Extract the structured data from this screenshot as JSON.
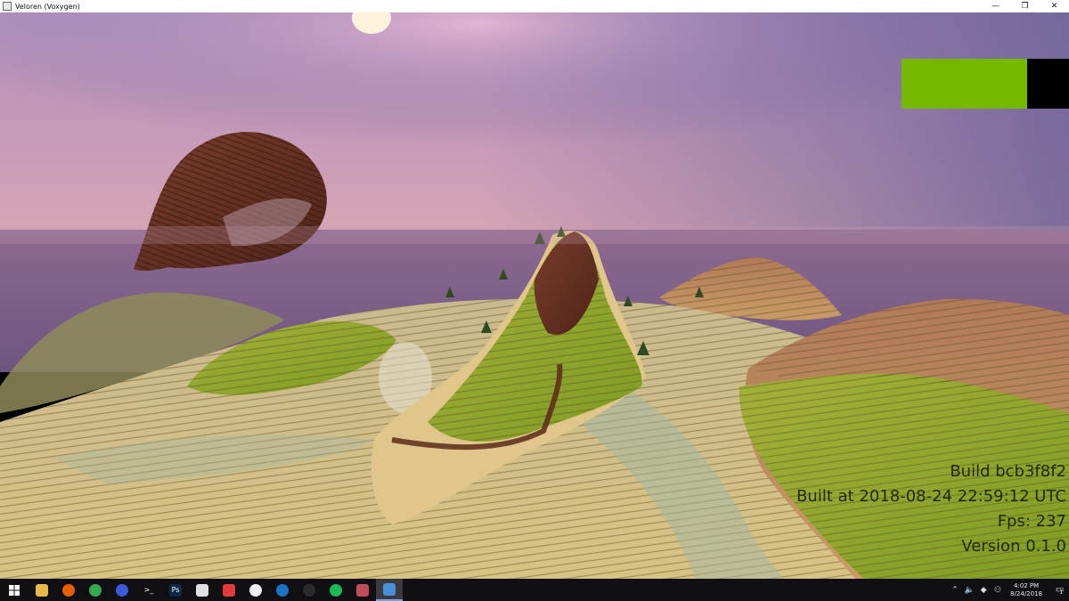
{
  "window": {
    "title": "Veloren (Voxygen)",
    "minimize": "—",
    "restore": "❐",
    "close": "✕"
  },
  "hud": {
    "bar_fill_fraction": 0.75,
    "bar_fill_color": "#74b800",
    "bar_empty_color": "#000000",
    "build_label": "Build bcb3f8f2",
    "built_at_label": "Built at 2018-08-24 22:59:12 UTC",
    "fps_label": "Fps: 237",
    "version_label": "Version 0.1.0"
  },
  "taskbar": {
    "apps": [
      {
        "icon": "file-explorer-icon",
        "color": "#e8b84a",
        "glyph": ""
      },
      {
        "icon": "firefox-icon",
        "color": "#e66000",
        "glyph": ""
      },
      {
        "icon": "chrome-icon",
        "color": "#34a853",
        "glyph": ""
      },
      {
        "icon": "firefox-dev-icon",
        "color": "#3b5bdb",
        "glyph": ""
      },
      {
        "icon": "terminal-icon",
        "color": "#111111",
        "glyph": ">_"
      },
      {
        "icon": "photoshop-icon",
        "color": "#0b2a4a",
        "glyph": "Ps"
      },
      {
        "icon": "twitch-icon",
        "color": "#e0e0e0",
        "glyph": ""
      },
      {
        "icon": "heart-app-icon",
        "color": "#e33b3b",
        "glyph": ""
      },
      {
        "icon": "overwatch-icon",
        "color": "#f0f0f0",
        "glyph": ""
      },
      {
        "icon": "steam-icon",
        "color": "#1b73c8",
        "glyph": ""
      },
      {
        "icon": "alien-app-icon",
        "color": "#2b2b2b",
        "glyph": ""
      },
      {
        "icon": "spotify-icon",
        "color": "#1db954",
        "glyph": ""
      },
      {
        "icon": "snipping-tool-icon",
        "color": "#c04d5a",
        "glyph": ""
      },
      {
        "icon": "veloren-window-icon",
        "color": "#4a90d9",
        "glyph": ""
      }
    ],
    "active_index": 13,
    "tray": {
      "chevron": "⌃",
      "volume": "🔈",
      "dropbox": "◆",
      "network": "⚇",
      "time": "4:02 PM",
      "date": "8/24/2018",
      "notification_count": "1"
    }
  }
}
